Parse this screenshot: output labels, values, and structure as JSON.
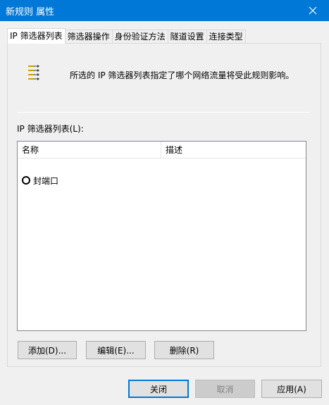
{
  "window": {
    "title": "新规则 属性",
    "close_icon": "close-icon"
  },
  "tabs": [
    {
      "label": "IP 筛选器列表",
      "active": true
    },
    {
      "label": "筛选器操作",
      "active": false
    },
    {
      "label": "身份验证方法",
      "active": false
    },
    {
      "label": "隧道设置",
      "active": false
    },
    {
      "label": "连接类型",
      "active": false
    }
  ],
  "panel": {
    "icon": "filter-list-icon",
    "description": "所选的 IP 筛选器列表指定了哪个网络流量将受此规则影响。",
    "list_label": "IP 筛选器列表(L):",
    "columns": {
      "name": "名称",
      "description": "描述"
    },
    "rows": [
      {
        "name": "封端口",
        "description": "",
        "selected": false
      }
    ],
    "buttons": {
      "add": "添加(D)...",
      "edit": "编辑(E)...",
      "delete": "删除(R)"
    }
  },
  "footer": {
    "close": "关闭",
    "cancel": "取消",
    "apply": "应用(A)"
  }
}
